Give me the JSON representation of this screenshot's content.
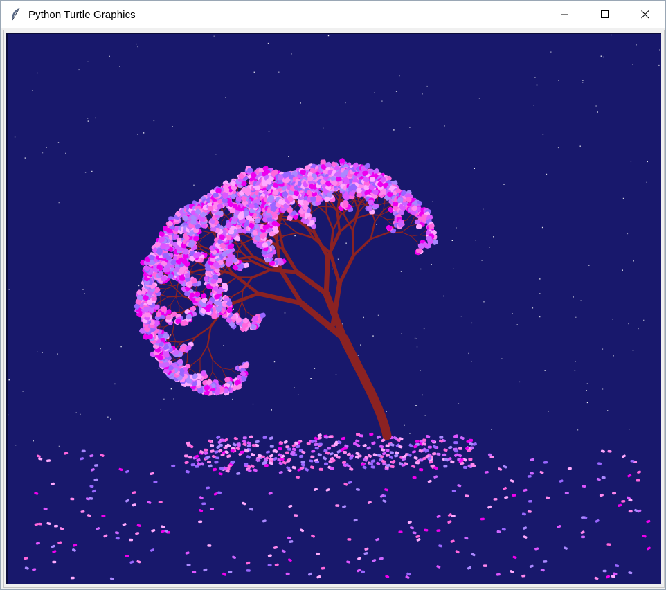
{
  "window": {
    "title": "Python Turtle Graphics",
    "controls": {
      "minimize": "minimize-icon",
      "maximize": "maximize-icon",
      "close": "close-icon"
    }
  },
  "canvas": {
    "background": "#18186c",
    "trunk_color": "#8b2222",
    "petal_colors": [
      "#ff88ee",
      "#cc66ff",
      "#aa88ff",
      "#ff66dd",
      "#ee00ee",
      "#ffaaff",
      "#9966ff",
      "#dd55ff"
    ],
    "star_color": "#ffffff"
  }
}
